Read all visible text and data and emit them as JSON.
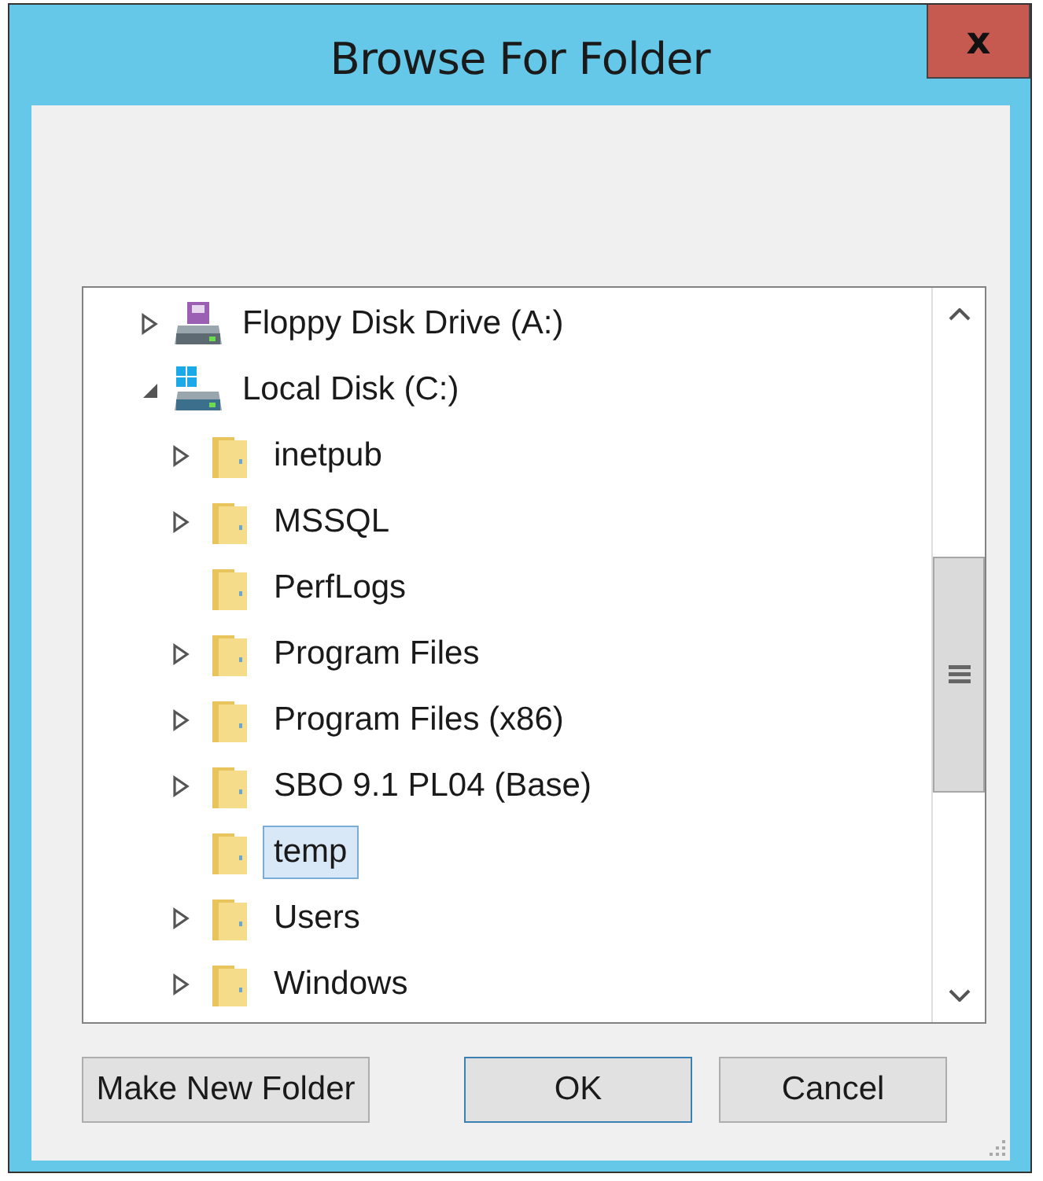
{
  "window": {
    "title": "Browse For Folder",
    "close": "x"
  },
  "tree": [
    {
      "label": "Floppy Disk Drive (A:)",
      "kind": "floppy",
      "expanded": false,
      "selected": false
    },
    {
      "label": "Local Disk (C:)",
      "kind": "disk",
      "expanded": true,
      "selected": false,
      "children": [
        {
          "label": "inetpub",
          "kind": "folder",
          "expanded": false,
          "selected": false
        },
        {
          "label": "MSSQL",
          "kind": "folder",
          "expanded": false,
          "selected": false
        },
        {
          "label": "PerfLogs",
          "kind": "folder",
          "selected": false
        },
        {
          "label": "Program Files",
          "kind": "folder",
          "expanded": false,
          "selected": false
        },
        {
          "label": "Program Files (x86)",
          "kind": "folder",
          "expanded": false,
          "selected": false
        },
        {
          "label": "SBO 9.1 PL04 (Base)",
          "kind": "folder",
          "expanded": false,
          "selected": false
        },
        {
          "label": "temp",
          "kind": "folder",
          "selected": true
        },
        {
          "label": "Users",
          "kind": "folder",
          "expanded": false,
          "selected": false
        },
        {
          "label": "Windows",
          "kind": "folder",
          "expanded": false,
          "selected": false
        }
      ]
    }
  ],
  "buttons": [
    {
      "label": "Make New Folder",
      "default": false
    },
    {
      "label": "OK",
      "default": true
    },
    {
      "label": "Cancel",
      "default": false
    }
  ]
}
